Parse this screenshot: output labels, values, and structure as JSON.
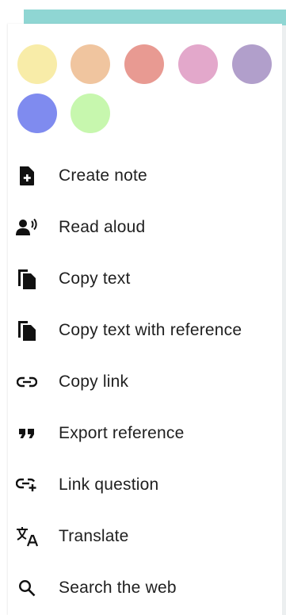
{
  "colors": {
    "accent_strip": "#8fd6d3",
    "text": "#1f1f1f",
    "icon": "#111111"
  },
  "swatches": [
    {
      "name": "yellow",
      "color": "#f8eca8"
    },
    {
      "name": "peach",
      "color": "#f0c59f"
    },
    {
      "name": "red",
      "color": "#e89a92"
    },
    {
      "name": "pink",
      "color": "#e3a8cb"
    },
    {
      "name": "purple",
      "color": "#b19fcb"
    },
    {
      "name": "blue",
      "color": "#7f8bef"
    },
    {
      "name": "green",
      "color": "#c7f7ae"
    }
  ],
  "menu": {
    "items": [
      {
        "label": "Create note",
        "icon": "note-add-icon"
      },
      {
        "label": "Read aloud",
        "icon": "speaker-person-icon"
      },
      {
        "label": "Copy text",
        "icon": "copy-icon"
      },
      {
        "label": "Copy text with reference",
        "icon": "copy-icon"
      },
      {
        "label": "Copy link",
        "icon": "link-icon"
      },
      {
        "label": "Export reference",
        "icon": "quote-icon"
      },
      {
        "label": "Link question",
        "icon": "link-add-icon"
      },
      {
        "label": "Translate",
        "icon": "translate-icon"
      },
      {
        "label": "Search the web",
        "icon": "search-icon"
      }
    ]
  }
}
